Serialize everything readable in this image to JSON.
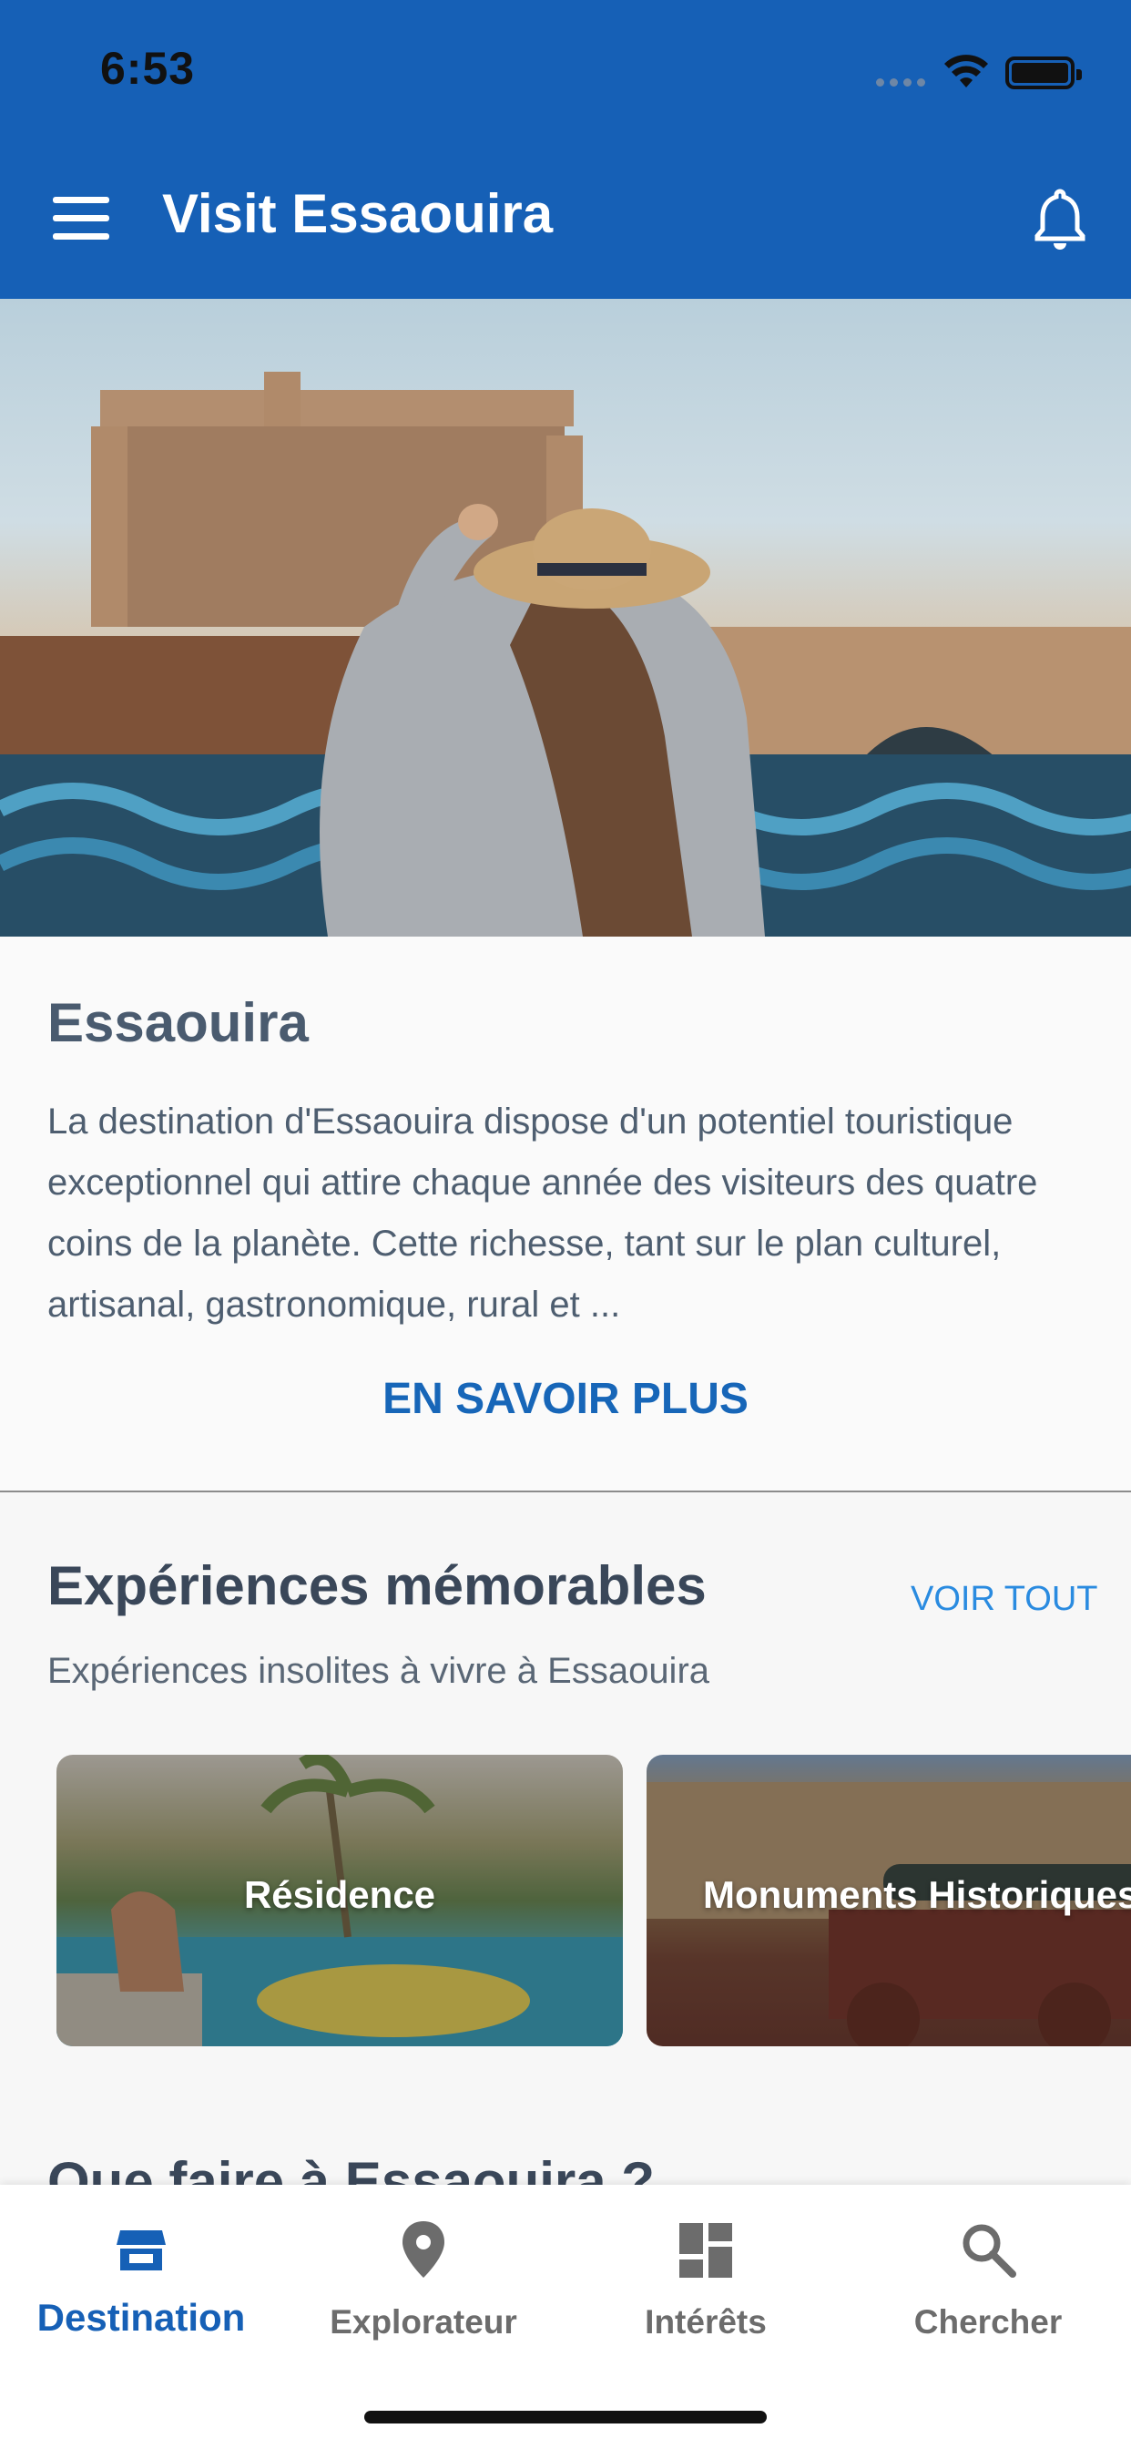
{
  "status_bar": {
    "time": "6:53"
  },
  "app_bar": {
    "title": "Visit Essaouira"
  },
  "intro": {
    "title": "Essaouira",
    "description": "La destination d'Essaouira dispose d'un potentiel touristique exceptionnel qui attire chaque année des visiteurs des quatre coins de la planète. Cette richesse, tant sur le plan culturel, artisanal, gastronomique, rural et ...",
    "more_label": "EN SAVOIR PLUS"
  },
  "experiences": {
    "title": "Expériences mémorables",
    "see_all": "VOIR TOUT",
    "subtitle": "Expériences insolites à vivre à Essaouira",
    "cards": [
      {
        "label": "Résidence"
      },
      {
        "label": "Monuments Historiques"
      }
    ]
  },
  "next_section": {
    "title": "Que faire à Essaouira ?"
  },
  "bottom_nav": {
    "items": [
      {
        "label": "Destination",
        "icon": "storefront-icon",
        "active": true
      },
      {
        "label": "Explorateur",
        "icon": "map-pin-icon",
        "active": false
      },
      {
        "label": "Intérêts",
        "icon": "dashboard-icon",
        "active": false
      },
      {
        "label": "Chercher",
        "icon": "search-icon",
        "active": false
      }
    ]
  },
  "colors": {
    "primary": "#1660b6",
    "link": "#2a8be0",
    "nav_inactive": "#6c6c6c"
  }
}
